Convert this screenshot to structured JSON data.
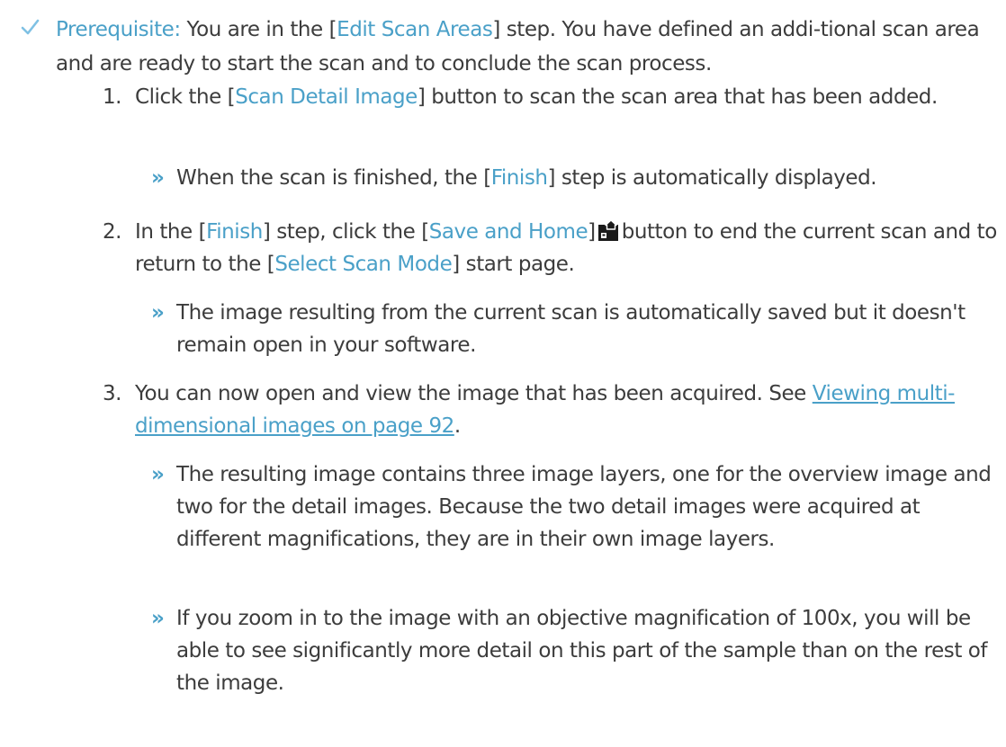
{
  "prerequisite": {
    "label": "Prerequisite:",
    "text_a": " You are in the [",
    "link_a": "Edit Scan Areas",
    "text_b": "] step. You have defined an addi-tional scan area and are ready to start the scan and to conclude the scan process."
  },
  "steps": [
    {
      "number": "1.",
      "t1": "Click the [",
      "h1": "Scan Detail Image",
      "t2": "] button to scan the scan area that has been added."
    },
    {
      "number": "2.",
      "t1": "In the [",
      "h1": "Finish",
      "t2": "] step, click the [",
      "h2": "Save and Home",
      "t3": "]",
      "t4": "button to end the current scan and to return to the [",
      "h3": "Select Scan Mode",
      "t5": "] start page."
    },
    {
      "number": "3.",
      "t1": "You can now open and view the image that has been acquired. See ",
      "link": "Viewing multi-dimensional images on page 92",
      "t2": "."
    }
  ],
  "results": [
    {
      "mark": "»",
      "t1": "When the scan is finished, the [",
      "h1": "Finish",
      "t2": "] step is automatically displayed."
    },
    {
      "mark": "»",
      "text": "The image resulting from the current scan is automatically saved but it doesn't remain open in your software."
    },
    {
      "mark": "»",
      "text": "The resulting image contains three image layers, one for the overview image and two for the detail images. Because the two detail images were acquired at different magnifications, they are in their own image layers."
    },
    {
      "mark": "»",
      "text": "If you zoom in to the image with an objective magnification of 100x, you will be able to see significantly more detail on this part of the sample than on the rest of the image."
    }
  ],
  "icons": {
    "check": "checkmark-icon",
    "save_home": "save-and-home-icon"
  },
  "colors": {
    "accent": "#4aa0c8",
    "text": "#3c3c3c"
  }
}
